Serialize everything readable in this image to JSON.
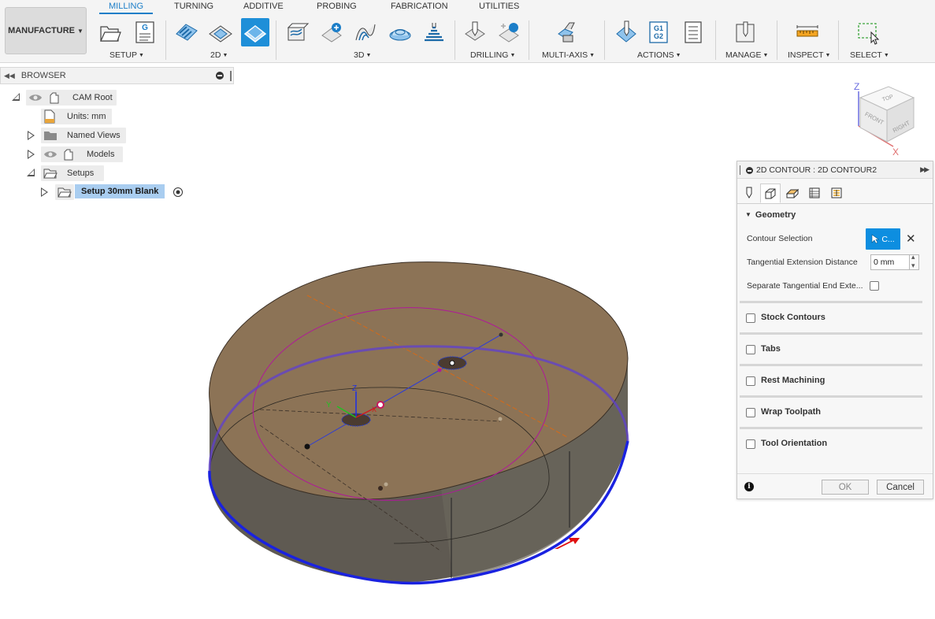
{
  "workspace": {
    "label": "MANUFACTURE"
  },
  "tabs": [
    {
      "label": "MILLING",
      "active": true
    },
    {
      "label": "TURNING"
    },
    {
      "label": "ADDITIVE"
    },
    {
      "label": "PROBING"
    },
    {
      "label": "FABRICATION"
    },
    {
      "label": "UTILITIES"
    }
  ],
  "groups": {
    "setup": "SETUP",
    "two_d": "2D",
    "three_d": "3D",
    "drilling": "DRILLING",
    "multi_axis": "MULTI-AXIS",
    "actions": "ACTIONS",
    "manage": "MANAGE",
    "inspect": "INSPECT",
    "select": "SELECT"
  },
  "actions_icon_text": {
    "line1": "G1",
    "line2": "G2"
  },
  "setup_icon_text": "G",
  "browser": {
    "title": "BROWSER",
    "items": [
      {
        "label": "CAM Root"
      },
      {
        "label": "Units: mm"
      },
      {
        "label": "Named Views"
      },
      {
        "label": "Models"
      },
      {
        "label": "Setups"
      },
      {
        "label": "Setup 30mm Blank",
        "selected": true
      }
    ]
  },
  "viewcube": {
    "faces": {
      "top": "TOP",
      "front": "FRONT",
      "right": "RIGHT"
    },
    "axes": {
      "z": "Z",
      "x": "X"
    }
  },
  "triad": {
    "z": "Z",
    "y": "Y",
    "x": "X"
  },
  "dialog": {
    "title": "2D CONTOUR : 2D CONTOUR2",
    "active_tab": 1,
    "geometry": {
      "header": "Geometry",
      "contour_selection_label": "Contour Selection",
      "contour_selection_button": "C...",
      "tangential_label": "Tangential Extension Distance",
      "tangential_value": "0 mm",
      "separate_label": "Separate Tangential End Exte...",
      "separate_checked": false
    },
    "sections": [
      {
        "label": "Stock Contours",
        "checked": false
      },
      {
        "label": "Tabs",
        "checked": false
      },
      {
        "label": "Rest Machining",
        "checked": false
      },
      {
        "label": "Wrap Toolpath",
        "checked": false
      },
      {
        "label": "Tool Orientation",
        "checked": false
      }
    ],
    "ok": "OK",
    "cancel": "Cancel"
  },
  "colors": {
    "accent": "#1c7ec8",
    "active_tool": "#1e8fd8",
    "selection_button": "#0d8ee0",
    "selected_node": "#a9cdf0",
    "contour": "#1a22e0",
    "stock_top": "#8c7356",
    "stock_side": "#5f5a52"
  }
}
